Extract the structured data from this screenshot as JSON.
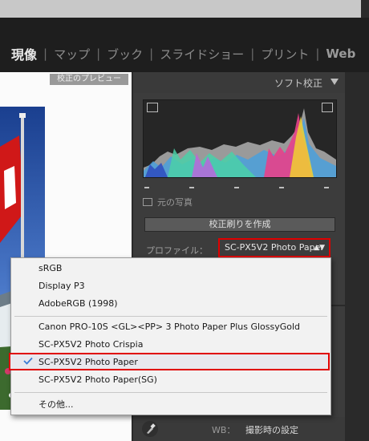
{
  "module_bar": {
    "modules": [
      "現像",
      "マップ",
      "ブック",
      "スライドショー",
      "プリント",
      "Web"
    ],
    "active": "現像"
  },
  "preview": {
    "label": "校正のプレビュー"
  },
  "softproof_panel": {
    "title": "ソフト校正",
    "original_photo_label": "元の写真",
    "create_proof_button": "校正刷りを作成",
    "profile_label": "プロファイル：",
    "profile_value": "SC-PX5V2 Photo Paper",
    "wb_label": "WB：",
    "wb_value": "撮影時の設定"
  },
  "profile_menu": {
    "items": [
      "sRGB",
      "Display P3",
      "AdobeRGB (1998)",
      "Canon PRO-10S <GL><PP> 3 Photo Paper Plus GlossyGold",
      "SC-PX5V2 Photo Crispia",
      "SC-PX5V2 Photo Paper",
      "SC-PX5V2 Photo Paper(SG)",
      "その他..."
    ],
    "selected": "SC-PX5V2 Photo Paper"
  },
  "colors": {
    "highlight_border": "#e00000",
    "panel_bg": "#3c3c3c",
    "module_bg": "#1e1e1e"
  }
}
